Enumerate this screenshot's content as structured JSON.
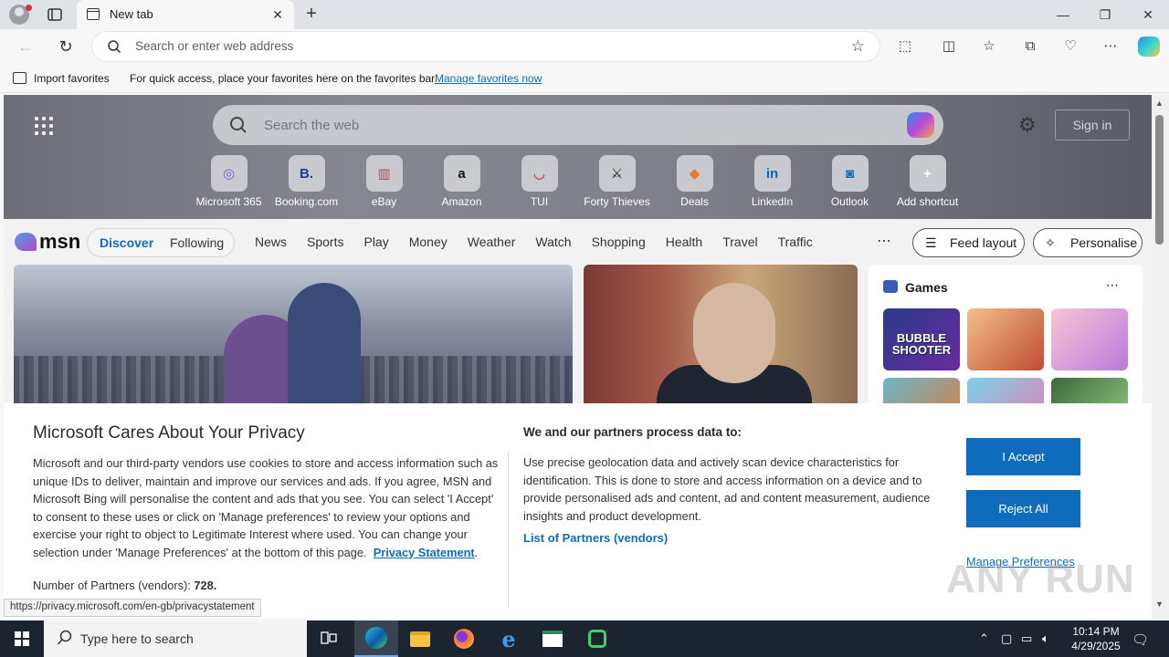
{
  "browser": {
    "tab_title": "New tab",
    "address_placeholder": "Search or enter web address",
    "favorites_bar": {
      "import_label": "Import favorites",
      "message": "For quick access, place your favorites here on the favorites bar.",
      "manage_link": "Manage favorites now"
    },
    "status_url": "https://privacy.microsoft.com/en-gb/privacystatement"
  },
  "newtab": {
    "search_placeholder": "Search the web",
    "sign_in": "Sign in",
    "shortcuts": [
      {
        "label": "Microsoft 365",
        "icon": "microsoft-365-icon",
        "glyph": "◎",
        "color": "#7a5bd8"
      },
      {
        "label": "Booking.com",
        "icon": "booking-icon",
        "glyph": "B.",
        "color": "#1b3d8f"
      },
      {
        "label": "eBay",
        "icon": "ebay-icon",
        "glyph": "▥",
        "color": "#e53238"
      },
      {
        "label": "Amazon",
        "icon": "amazon-icon",
        "glyph": "a",
        "color": "#111111"
      },
      {
        "label": "TUI",
        "icon": "tui-icon",
        "glyph": "◡",
        "color": "#e2001a"
      },
      {
        "label": "Forty Thieves",
        "icon": "forty-thieves-icon",
        "glyph": "⚔",
        "color": "#222222"
      },
      {
        "label": "Deals",
        "icon": "deals-icon",
        "glyph": "◆",
        "color": "#e8792b"
      },
      {
        "label": "LinkedIn",
        "icon": "linkedin-icon",
        "glyph": "in",
        "color": "#0a66c2"
      },
      {
        "label": "Outlook",
        "icon": "outlook-icon",
        "glyph": "◙",
        "color": "#0f6cbd"
      },
      {
        "label": "Add shortcut",
        "icon": "add-shortcut-icon",
        "glyph": "+",
        "color": "#ffffff"
      }
    ]
  },
  "msn": {
    "logo": "msn",
    "discover": "Discover",
    "following": "Following",
    "nav": [
      "News",
      "Sports",
      "Play",
      "Money",
      "Weather",
      "Watch",
      "Shopping",
      "Health",
      "Travel",
      "Traffic"
    ],
    "feed_layout": "Feed layout",
    "personalise": "Personalise",
    "games_title": "Games",
    "game_tiles": [
      "BUBBLE SHOOTER",
      "",
      "",
      "",
      "",
      ""
    ]
  },
  "privacy": {
    "title": "Microsoft Cares About Your Privacy",
    "body": "Microsoft and our third-party vendors use cookies to store and access information such as unique IDs to deliver, maintain and improve our services and ads. If you agree, MSN and Microsoft Bing will personalise the content and ads that you see. You can select 'I Accept' to consent to these uses or click on 'Manage preferences' to review your options and exercise your right to object to Legitimate Interest where used.  You can change your selection under 'Manage Preferences' at the bottom of this page.",
    "privacy_link": "Privacy Statement",
    "partners_count_label": "Number of Partners (vendors):",
    "partners_count": "728.",
    "purpose_heading": "We and our partners process data to:",
    "purpose_text": "Use precise geolocation data and actively scan device characteristics for identification. This is done to store and access information on a device and to provide personalised ads and content, ad and content measurement, audience insights and product development.",
    "partners_link": "List of Partners (vendors)",
    "accept": "I Accept",
    "reject": "Reject All",
    "manage": "Manage Preferences"
  },
  "watermark": "ANY RUN",
  "taskbar": {
    "search_placeholder": "Type here to search",
    "time": "10:14 PM",
    "date": "4/29/2025"
  }
}
